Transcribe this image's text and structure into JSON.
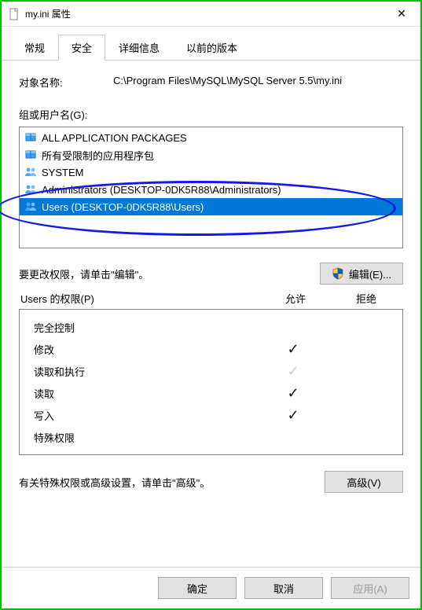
{
  "window": {
    "title": "my.ini 属性"
  },
  "tabs": {
    "items": [
      "常规",
      "安全",
      "详细信息",
      "以前的版本"
    ],
    "active_index": 1
  },
  "object": {
    "label": "对象名称:",
    "value": "C:\\Program Files\\MySQL\\MySQL Server 5.5\\my.ini"
  },
  "groups": {
    "label": "组或用户名(G):",
    "items": [
      {
        "icon": "package",
        "text": "ALL APPLICATION PACKAGES"
      },
      {
        "icon": "package",
        "text": "所有受限制的应用程序包"
      },
      {
        "icon": "group",
        "text": "SYSTEM"
      },
      {
        "icon": "group",
        "text": "Administrators (DESKTOP-0DK5R88\\Administrators)"
      },
      {
        "icon": "group",
        "text": "Users (DESKTOP-0DK5R88\\Users)"
      }
    ],
    "selected_index": 4
  },
  "edit_hint": {
    "text": "要更改权限，请单击\"编辑\"。",
    "button": "编辑(E)..."
  },
  "permissions": {
    "header_left": "Users 的权限(P)",
    "allow_label": "允许",
    "deny_label": "拒绝",
    "rows": [
      {
        "name": "完全控制",
        "allow": "none",
        "deny": "none"
      },
      {
        "name": "修改",
        "allow": "on",
        "deny": "none"
      },
      {
        "name": "读取和执行",
        "allow": "off",
        "deny": "none"
      },
      {
        "name": "读取",
        "allow": "on",
        "deny": "none"
      },
      {
        "name": "写入",
        "allow": "on",
        "deny": "none"
      },
      {
        "name": "特殊权限",
        "allow": "none",
        "deny": "none"
      }
    ]
  },
  "advanced_hint": {
    "text": "有关特殊权限或高级设置，请单击\"高级\"。",
    "button": "高级(V)"
  },
  "footer": {
    "ok": "确定",
    "cancel": "取消",
    "apply": "应用(A)"
  }
}
